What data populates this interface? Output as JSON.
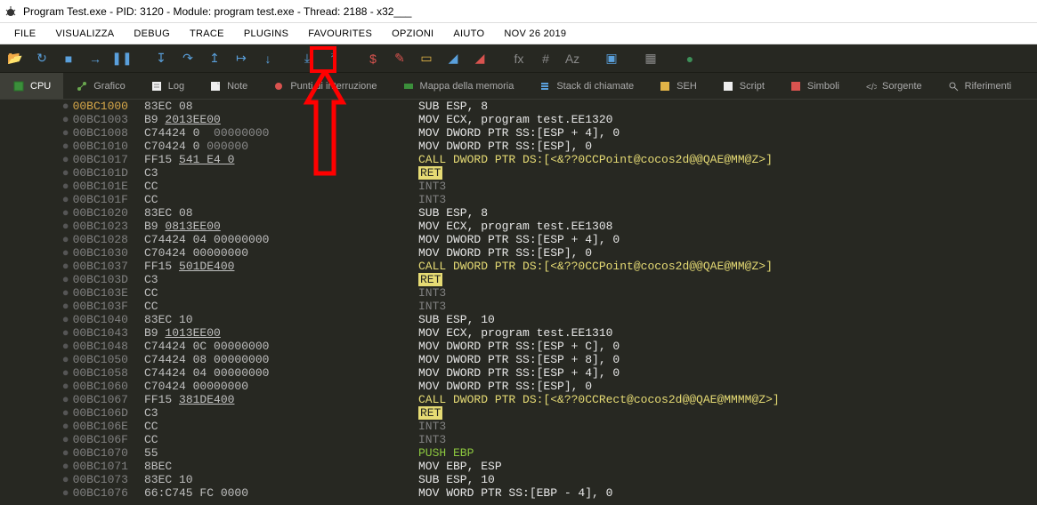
{
  "title": "Program Test.exe - PID: 3120 - Module: program test.exe - Thread: 2188 - x32___",
  "menus": [
    "FILE",
    "VISUALIZZA",
    "DEBUG",
    "TRACE",
    "PLUGINS",
    "FAVOURITES",
    "OPZIONI",
    "AIUTO",
    "NOV 26 2019"
  ],
  "tabs": [
    {
      "icon": "cpu",
      "label": "CPU",
      "active": true
    },
    {
      "icon": "graph",
      "label": "Grafico"
    },
    {
      "icon": "log",
      "label": "Log"
    },
    {
      "icon": "note",
      "label": "Note"
    },
    {
      "icon": "bp",
      "label": "Punti di interruzione"
    },
    {
      "icon": "mem",
      "label": "Mappa della memoria"
    },
    {
      "icon": "stack",
      "label": "Stack di chiamate"
    },
    {
      "icon": "seh",
      "label": "SEH"
    },
    {
      "icon": "script",
      "label": "Script"
    },
    {
      "icon": "sym",
      "label": "Simboli"
    },
    {
      "icon": "src",
      "label": "Sorgente"
    },
    {
      "icon": "ref",
      "label": "Riferimenti"
    }
  ],
  "rows": [
    {
      "addr": "00BC1000",
      "addr_hl": true,
      "bytes": "83EC 08",
      "instr": [
        {
          "t": "SUB ESP, 8",
          "c": "clr-white"
        }
      ]
    },
    {
      "addr": "00BC1003",
      "bytes": "B9 ",
      "bytes2": "2013EE00",
      "bytes2_ul": true,
      "instr": [
        {
          "t": "MOV ECX, program test.EE1320",
          "c": "clr-white"
        }
      ]
    },
    {
      "addr": "00BC1008",
      "bytes": "C74424 0",
      "bytes_dim": "  00000000",
      "instr": [
        {
          "t": "MOV DWORD PTR SS:[ESP + 4], 0",
          "c": "clr-white"
        }
      ]
    },
    {
      "addr": "00BC1010",
      "bytes": "C70424 0",
      "bytes_dim": " 000000",
      "instr": [
        {
          "t": "MOV DWORD PTR SS:[ESP], 0",
          "c": "clr-white"
        }
      ]
    },
    {
      "addr": "00BC1017",
      "bytes": "FF15 ",
      "bytes2": "541 E4 0",
      "bytes2_ul": true,
      "instr": [
        {
          "t": "CALL DWORD PTR DS:[<&??0CCPoint@cocos2d@@QAE@MM@Z>]",
          "c": "clr-yellow"
        }
      ]
    },
    {
      "addr": "00BC101D",
      "bytes": "C3",
      "instr": [
        {
          "t": "RET",
          "c": "bg-yellow"
        }
      ]
    },
    {
      "addr": "00BC101E",
      "bytes": "CC",
      "instr": [
        {
          "t": "INT3",
          "c": "clr-gray"
        }
      ]
    },
    {
      "addr": "00BC101F",
      "bytes": "CC",
      "instr": [
        {
          "t": "INT3",
          "c": "clr-gray"
        }
      ]
    },
    {
      "addr": "00BC1020",
      "bytes": "83EC 08",
      "instr": [
        {
          "t": "SUB ESP, 8",
          "c": "clr-white"
        }
      ]
    },
    {
      "addr": "00BC1023",
      "bytes": "B9 ",
      "bytes2": "0813EE00",
      "bytes2_ul": true,
      "instr": [
        {
          "t": "MOV ECX, program test.EE1308",
          "c": "clr-white"
        }
      ]
    },
    {
      "addr": "00BC1028",
      "bytes": "C74424 04 00000000",
      "instr": [
        {
          "t": "MOV DWORD PTR SS:[ESP + 4], 0",
          "c": "clr-white"
        }
      ]
    },
    {
      "addr": "00BC1030",
      "bytes": "C70424 00000000",
      "instr": [
        {
          "t": "MOV DWORD PTR SS:[ESP], 0",
          "c": "clr-white"
        }
      ]
    },
    {
      "addr": "00BC1037",
      "bytes": "FF15 ",
      "bytes2": "501DE400",
      "bytes2_ul": true,
      "instr": [
        {
          "t": "CALL DWORD PTR DS:[<&??0CCPoint@cocos2d@@QAE@MM@Z>]",
          "c": "clr-yellow"
        }
      ]
    },
    {
      "addr": "00BC103D",
      "bytes": "C3",
      "instr": [
        {
          "t": "RET",
          "c": "bg-yellow"
        }
      ]
    },
    {
      "addr": "00BC103E",
      "bytes": "CC",
      "instr": [
        {
          "t": "INT3",
          "c": "clr-gray"
        }
      ]
    },
    {
      "addr": "00BC103F",
      "bytes": "CC",
      "instr": [
        {
          "t": "INT3",
          "c": "clr-gray"
        }
      ]
    },
    {
      "addr": "00BC1040",
      "bytes": "83EC 10",
      "instr": [
        {
          "t": "SUB ESP, 10",
          "c": "clr-white"
        }
      ]
    },
    {
      "addr": "00BC1043",
      "bytes": "B9 ",
      "bytes2": "1013EE00",
      "bytes2_ul": true,
      "instr": [
        {
          "t": "MOV ECX, program test.EE1310",
          "c": "clr-white"
        }
      ]
    },
    {
      "addr": "00BC1048",
      "bytes": "C74424 0C 00000000",
      "instr": [
        {
          "t": "MOV DWORD PTR SS:[ESP + C], 0",
          "c": "clr-white"
        }
      ]
    },
    {
      "addr": "00BC1050",
      "bytes": "C74424 08 00000000",
      "instr": [
        {
          "t": "MOV DWORD PTR SS:[ESP + 8], 0",
          "c": "clr-white"
        }
      ]
    },
    {
      "addr": "00BC1058",
      "bytes": "C74424 04 00000000",
      "instr": [
        {
          "t": "MOV DWORD PTR SS:[ESP + 4], 0",
          "c": "clr-white"
        }
      ]
    },
    {
      "addr": "00BC1060",
      "bytes": "C70424 00000000",
      "instr": [
        {
          "t": "MOV DWORD PTR SS:[ESP], 0",
          "c": "clr-white"
        }
      ]
    },
    {
      "addr": "00BC1067",
      "bytes": "FF15 ",
      "bytes2": "381DE400",
      "bytes2_ul": true,
      "instr": [
        {
          "t": "CALL DWORD PTR DS:[<&??0CCRect@cocos2d@@QAE@MMMM@Z>]",
          "c": "clr-yellow"
        }
      ]
    },
    {
      "addr": "00BC106D",
      "bytes": "C3",
      "instr": [
        {
          "t": "RET",
          "c": "bg-yellow"
        }
      ]
    },
    {
      "addr": "00BC106E",
      "bytes": "CC",
      "instr": [
        {
          "t": "INT3",
          "c": "clr-gray"
        }
      ]
    },
    {
      "addr": "00BC106F",
      "bytes": "CC",
      "instr": [
        {
          "t": "INT3",
          "c": "clr-gray"
        }
      ]
    },
    {
      "addr": "00BC1070",
      "bytes": "55",
      "instr": [
        {
          "t": "PUSH EBP",
          "c": "clr-green"
        }
      ]
    },
    {
      "addr": "00BC1071",
      "bytes": "8BEC",
      "instr": [
        {
          "t": "MOV EBP, ESP",
          "c": "clr-white"
        }
      ]
    },
    {
      "addr": "00BC1073",
      "bytes": "83EC 10",
      "instr": [
        {
          "t": "SUB ESP, 10",
          "c": "clr-white"
        }
      ]
    },
    {
      "addr": "00BC1076",
      "bytes": "66:C745 FC 0000",
      "instr": [
        {
          "t": "MOV WORD PTR SS:[EBP - 4], 0",
          "c": "clr-white"
        }
      ]
    }
  ],
  "toolbar_icons": [
    {
      "n": "folder-open-icon",
      "g": "📂",
      "c": "#e2b447"
    },
    {
      "n": "restart-icon",
      "g": "↻",
      "c": "#5aa0dc"
    },
    {
      "n": "stop-icon",
      "g": "■",
      "c": "#5aa0dc"
    },
    {
      "n": "run-icon",
      "g": "→",
      "c": "#5aa0dc"
    },
    {
      "n": "pause-icon",
      "g": "❚❚",
      "c": "#5aa0dc"
    },
    {
      "n": "sep"
    },
    {
      "n": "step-into-icon",
      "g": "↧",
      "c": "#5aa0dc"
    },
    {
      "n": "step-over-icon",
      "g": "↷",
      "c": "#5aa0dc"
    },
    {
      "n": "step-out-icon",
      "g": "↥",
      "c": "#5aa0dc"
    },
    {
      "n": "step-icon",
      "g": "↦",
      "c": "#5aa0dc"
    },
    {
      "n": "step-down-icon",
      "g": "↓",
      "c": "#5aa0dc"
    },
    {
      "n": "sep"
    },
    {
      "n": "trace-into-icon",
      "g": "⤓",
      "c": "#5aa0dc"
    },
    {
      "n": "trace-over-icon",
      "g": "⤒",
      "c": "#5aa0dc"
    },
    {
      "n": "sep"
    },
    {
      "n": "patch-dollar-icon",
      "g": "$",
      "c": "#d9534f"
    },
    {
      "n": "patch-edit-icon",
      "g": "✎",
      "c": "#d9534f"
    },
    {
      "n": "patch-list-icon",
      "g": "▭",
      "c": "#e2b447"
    },
    {
      "n": "patch-blue-icon",
      "g": "◢",
      "c": "#5aa0dc"
    },
    {
      "n": "patch-red-icon",
      "g": "◢",
      "c": "#d9534f"
    },
    {
      "n": "sep"
    },
    {
      "n": "fx-icon",
      "g": "fx",
      "c": "#8a8a8a"
    },
    {
      "n": "hash-icon",
      "g": "#",
      "c": "#8a8a8a"
    },
    {
      "n": "az-icon",
      "g": "Aᴢ",
      "c": "#8a8a8a"
    },
    {
      "n": "sep"
    },
    {
      "n": "screen-icon",
      "g": "▣",
      "c": "#5aa0dc"
    },
    {
      "n": "sep"
    },
    {
      "n": "calc-icon",
      "g": "▦",
      "c": "#8a8a8a"
    },
    {
      "n": "sep"
    },
    {
      "n": "globe-icon",
      "g": "●",
      "c": "#3d8f58"
    }
  ]
}
